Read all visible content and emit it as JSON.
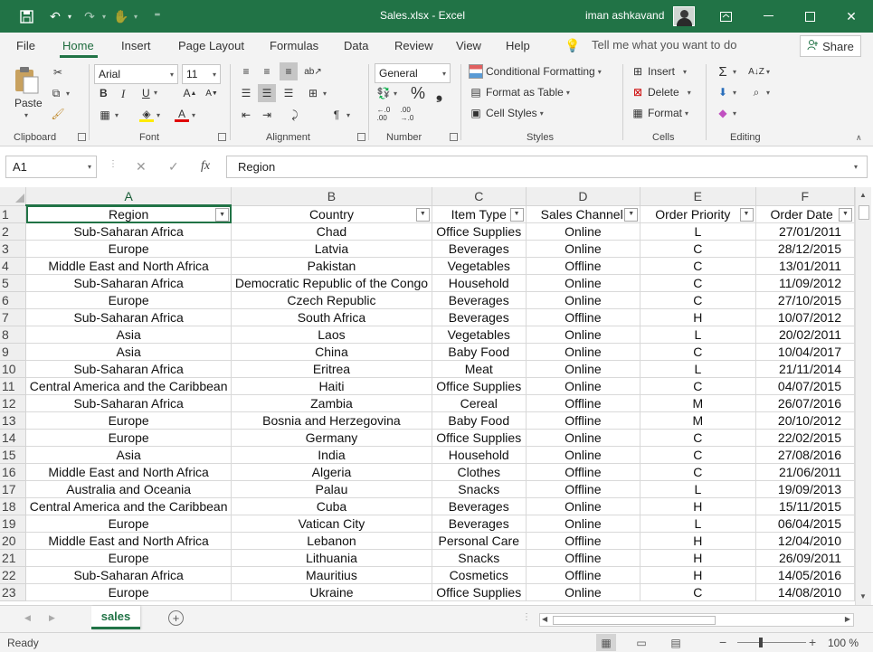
{
  "titlebar": {
    "title": "Sales.xlsx  -  Excel",
    "user": "iman ashkavand",
    "qa_dropdown": "⁼"
  },
  "menu": {
    "items": [
      "File",
      "Home",
      "Insert",
      "Page Layout",
      "Formulas",
      "Data",
      "Review",
      "View",
      "Help"
    ],
    "tell_me": "Tell me what you want to do",
    "share": "Share"
  },
  "ribbon": {
    "clipboard": {
      "paste": "Paste",
      "label": "Clipboard"
    },
    "font": {
      "name": "Arial",
      "size": "11",
      "bold": "B",
      "italic": "I",
      "underline": "U",
      "label": "Font"
    },
    "alignment": {
      "label": "Alignment"
    },
    "number": {
      "format": "General",
      "percent": "%",
      "comma": "❟",
      "label": "Number"
    },
    "styles": {
      "conditional": "Conditional Formatting",
      "format_table": "Format as Table",
      "cell_styles": "Cell Styles",
      "label": "Styles"
    },
    "cells": {
      "insert": "Insert",
      "delete": "Delete",
      "format": "Format",
      "label": "Cells"
    },
    "editing": {
      "label": "Editing"
    }
  },
  "formula_bar": {
    "name_box": "A1",
    "fx": "fx",
    "content": "Region"
  },
  "sheet": {
    "columns": [
      "A",
      "B",
      "C",
      "D",
      "E",
      "F"
    ],
    "headers": [
      "Region",
      "Country",
      "Item Type",
      "Sales Channel",
      "Order Priority",
      "Order Date"
    ],
    "rows": [
      [
        "Sub-Saharan Africa",
        "Chad",
        "Office Supplies",
        "Online",
        "L",
        "27/01/2011"
      ],
      [
        "Europe",
        "Latvia",
        "Beverages",
        "Online",
        "C",
        "28/12/2015"
      ],
      [
        "Middle East and North Africa",
        "Pakistan",
        "Vegetables",
        "Offline",
        "C",
        "13/01/2011"
      ],
      [
        "Sub-Saharan Africa",
        "Democratic Republic of the Congo",
        "Household",
        "Online",
        "C",
        "11/09/2012"
      ],
      [
        "Europe",
        "Czech Republic",
        "Beverages",
        "Online",
        "C",
        "27/10/2015"
      ],
      [
        "Sub-Saharan Africa",
        "South Africa",
        "Beverages",
        "Offline",
        "H",
        "10/07/2012"
      ],
      [
        "Asia",
        "Laos",
        "Vegetables",
        "Online",
        "L",
        "20/02/2011"
      ],
      [
        "Asia",
        "China",
        "Baby Food",
        "Online",
        "C",
        "10/04/2017"
      ],
      [
        "Sub-Saharan Africa",
        "Eritrea",
        "Meat",
        "Online",
        "L",
        "21/11/2014"
      ],
      [
        "Central America and the Caribbean",
        "Haiti",
        "Office Supplies",
        "Online",
        "C",
        "04/07/2015"
      ],
      [
        "Sub-Saharan Africa",
        "Zambia",
        "Cereal",
        "Offline",
        "M",
        "26/07/2016"
      ],
      [
        "Europe",
        "Bosnia and Herzegovina",
        "Baby Food",
        "Offline",
        "M",
        "20/10/2012"
      ],
      [
        "Europe",
        "Germany",
        "Office Supplies",
        "Online",
        "C",
        "22/02/2015"
      ],
      [
        "Asia",
        "India",
        "Household",
        "Online",
        "C",
        "27/08/2016"
      ],
      [
        "Middle East and North Africa",
        "Algeria",
        "Clothes",
        "Offline",
        "C",
        "21/06/2011"
      ],
      [
        "Australia and Oceania",
        "Palau",
        "Snacks",
        "Offline",
        "L",
        "19/09/2013"
      ],
      [
        "Central America and the Caribbean",
        "Cuba",
        "Beverages",
        "Online",
        "H",
        "15/11/2015"
      ],
      [
        "Europe",
        "Vatican City",
        "Beverages",
        "Online",
        "L",
        "06/04/2015"
      ],
      [
        "Middle East and North Africa",
        "Lebanon",
        "Personal Care",
        "Offline",
        "H",
        "12/04/2010"
      ],
      [
        "Europe",
        "Lithuania",
        "Snacks",
        "Offline",
        "H",
        "26/09/2011"
      ],
      [
        "Sub-Saharan Africa",
        "Mauritius",
        "Cosmetics",
        "Offline",
        "H",
        "14/05/2016"
      ],
      [
        "Europe",
        "Ukraine",
        "Office Supplies",
        "Online",
        "C",
        "14/08/2010"
      ]
    ]
  },
  "tabs": {
    "active": "sales"
  },
  "status": {
    "ready": "Ready",
    "zoom": "100 %"
  }
}
